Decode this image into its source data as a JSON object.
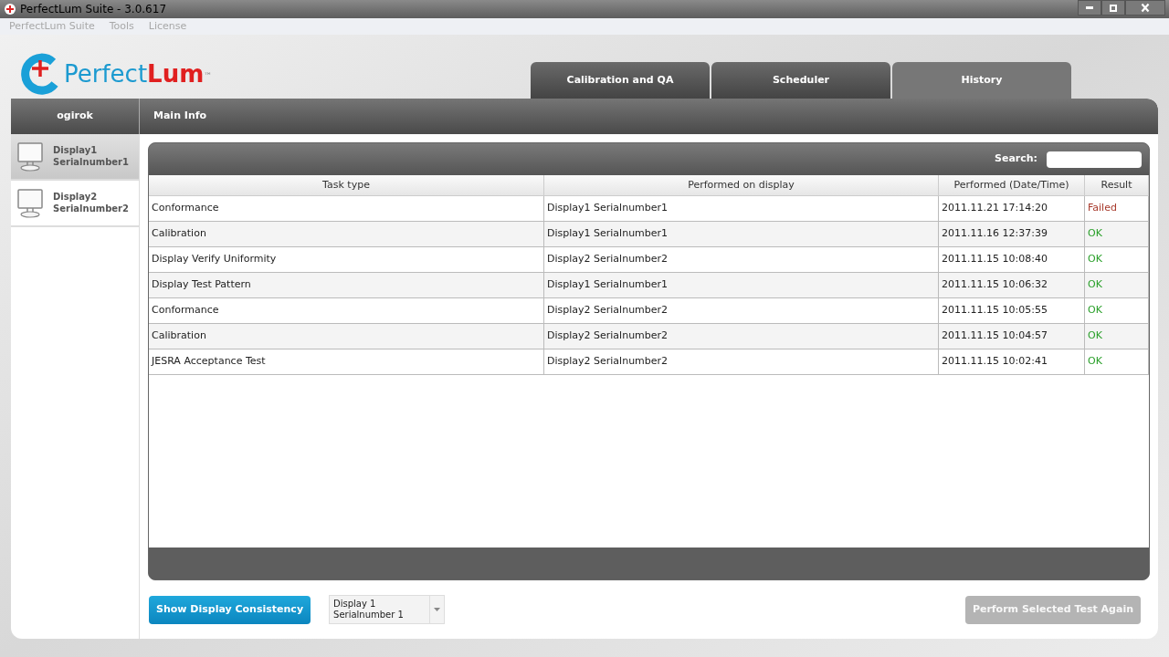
{
  "window": {
    "title": "PerfectLum Suite - 3.0.617"
  },
  "menu": [
    "PerfectLum Suite",
    "Tools",
    "License"
  ],
  "logo": {
    "part_1": "Perfect",
    "part_2": "Lum",
    "mark": "™"
  },
  "tabs": [
    {
      "label": "Calibration and QA",
      "selected": false
    },
    {
      "label": "Scheduler",
      "selected": false
    },
    {
      "label": "History",
      "selected": true
    }
  ],
  "user": "ogirok",
  "section_title": "Main Info",
  "displays": [
    {
      "name": "Display1",
      "serial": "Serialnumber1",
      "selected": true
    },
    {
      "name": "Display2",
      "serial": "Serialnumber2",
      "selected": false
    }
  ],
  "search": {
    "label": "Search:"
  },
  "table": {
    "columns": [
      "Task type",
      "Performed on display",
      "Performed (Date/Time)",
      "Result"
    ],
    "rows": [
      {
        "cells": [
          "Conformance",
          "Display1 Serialnumber1",
          "2011.11.21 17:14:20",
          "Failed"
        ],
        "color": "#a83a2c"
      },
      {
        "cells": [
          "Calibration",
          "Display1 Serialnumber1",
          "2011.11.16 12:37:39",
          "OK"
        ],
        "color": "#2aa02a"
      },
      {
        "cells": [
          "Display Verify Uniformity",
          "Display2 Serialnumber2",
          "2011.11.15 10:08:40",
          "OK"
        ],
        "color": "#2aa02a"
      },
      {
        "cells": [
          "Display Test Pattern",
          "Display1 Serialnumber1",
          "2011.11.15 10:06:32",
          "OK"
        ],
        "color": "#2aa02a"
      },
      {
        "cells": [
          "Conformance",
          "Display2 Serialnumber2",
          "2011.11.15 10:05:55",
          "OK"
        ],
        "color": "#2aa02a"
      },
      {
        "cells": [
          "Calibration",
          "Display2 Serialnumber2",
          "2011.11.15 10:04:57",
          "OK"
        ],
        "color": "#2aa02a"
      },
      {
        "cells": [
          "JESRA Acceptance Test",
          "Display2 Serialnumber2",
          "2011.11.15 10:02:41",
          "OK"
        ],
        "color": "#2aa02a"
      }
    ]
  },
  "consistency_button": {
    "label": "Show Display Consistency",
    "disabled": false
  },
  "display_select": {
    "value_line_1": "Display 1",
    "value_line_2": "Serialnumber 1"
  },
  "repeat_button": {
    "label": "Perform Selected Test Again",
    "disabled": true
  }
}
